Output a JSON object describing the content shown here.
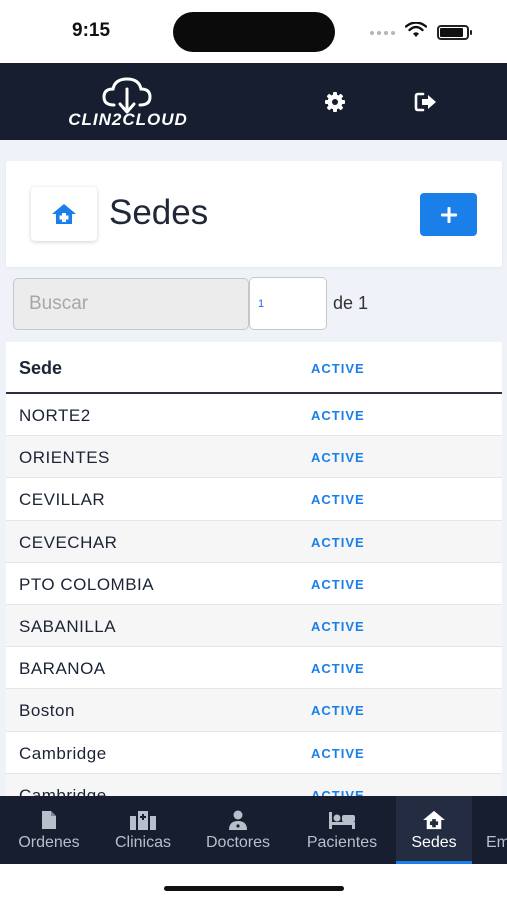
{
  "status_bar": {
    "time": "9:15",
    "battery_level": 0.9
  },
  "header": {
    "logo_text": "CLIN2CLOUD",
    "settings_icon": "gear-icon",
    "logout_icon": "logout-icon"
  },
  "page": {
    "title": "Sedes",
    "title_icon": "clinic-home-icon",
    "add_icon": "plus-icon"
  },
  "search": {
    "placeholder": "Buscar",
    "value": ""
  },
  "pagination": {
    "current_page": "1",
    "of_label": "de 1"
  },
  "table": {
    "columns": {
      "name": "Sede",
      "status": "ACTIVE"
    },
    "rows": [
      {
        "name": "NORTE2",
        "status": "ACTIVE"
      },
      {
        "name": "ORIENTES",
        "status": "ACTIVE"
      },
      {
        "name": "CEVILLAR",
        "status": "ACTIVE"
      },
      {
        "name": "CEVECHAR",
        "status": "ACTIVE"
      },
      {
        "name": "PTO COLOMBIA",
        "status": "ACTIVE"
      },
      {
        "name": "SABANILLA",
        "status": "ACTIVE"
      },
      {
        "name": "BARANOA",
        "status": "ACTIVE"
      },
      {
        "name": "Boston",
        "status": "ACTIVE"
      },
      {
        "name": "Cambridge",
        "status": "ACTIVE"
      },
      {
        "name": "Cambridge",
        "status": "ACTIVE"
      }
    ]
  },
  "bottom_nav": {
    "items": [
      {
        "label": "Ordenes",
        "icon": "document-icon"
      },
      {
        "label": "Clinicas",
        "icon": "clinic-building-icon"
      },
      {
        "label": "Doctores",
        "icon": "doctor-icon"
      },
      {
        "label": "Pacientes",
        "icon": "bed-icon"
      },
      {
        "label": "Sedes",
        "icon": "clinic-home-icon",
        "active": true
      },
      {
        "label": "Em",
        "icon": ""
      }
    ]
  },
  "colors": {
    "primary": "#1a7fe8",
    "header_bg": "#161e30",
    "content_bg": "#eff3f9"
  }
}
